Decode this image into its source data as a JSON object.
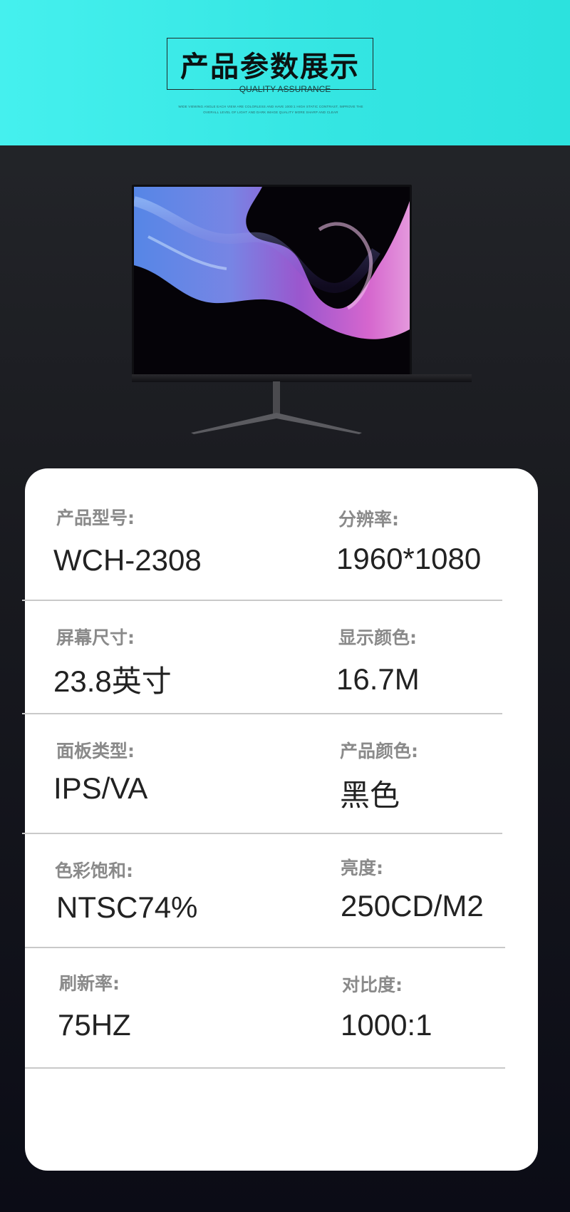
{
  "header": {
    "title": "产品参数展示",
    "subtitle": "QUALITY ASSURANCE",
    "tiny_line_1": "WIDE VIEWING ANGLE EACH VIEW ARE COLORLESS AND HAVE 1000:1 HIGH STATIC CONTRAST, IMPROVE THE",
    "tiny_line_2": "OVERALL LEVEL OF LIGHT AND DARK IMAGE QUALITY MORE SHARP AND CLEAR"
  },
  "colors": {
    "header_bg": "#3aebe8",
    "page_bg": "#1c1d22",
    "card_bg": "#ffffff",
    "label": "#8a8a8a",
    "value": "#222222"
  },
  "specs": [
    {
      "label": "产品型号:",
      "value": "WCH-2308"
    },
    {
      "label": "分辨率:",
      "value": "1960*1080"
    },
    {
      "label": "屏幕尺寸:",
      "value": "23.8英寸"
    },
    {
      "label": "显示颜色:",
      "value": "16.7M"
    },
    {
      "label": "面板类型:",
      "value": "IPS/VA"
    },
    {
      "label": "产品颜色:",
      "value": "黑色"
    },
    {
      "label": "色彩饱和:",
      "value": "NTSC74%"
    },
    {
      "label": "亮度:",
      "value": "250CD/M2"
    },
    {
      "label": "刷新率:",
      "value": "75HZ"
    },
    {
      "label": "对比度:",
      "value": "1000:1"
    }
  ]
}
